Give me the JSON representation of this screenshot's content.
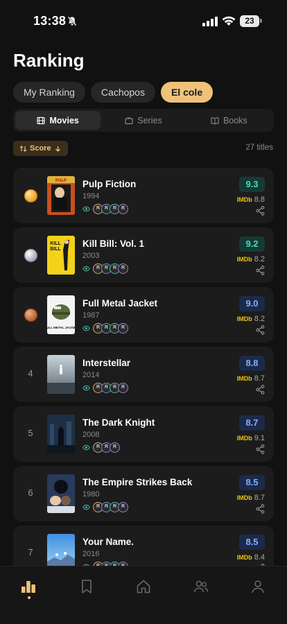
{
  "status": {
    "time": "13:38",
    "battery": "23"
  },
  "page": {
    "title": "Ranking"
  },
  "chips": [
    {
      "label": "My Ranking",
      "active": false
    },
    {
      "label": "Cachopos",
      "active": false
    },
    {
      "label": "El cole",
      "active": true
    }
  ],
  "segments": [
    {
      "label": "Movies",
      "icon": "film-icon",
      "active": true
    },
    {
      "label": "Series",
      "icon": "tv-icon",
      "active": false
    },
    {
      "label": "Books",
      "icon": "book-icon",
      "active": false
    }
  ],
  "sort": {
    "label": "Score"
  },
  "count": "27 titles",
  "imdb_label": "IMDb",
  "avatar_letter": "R",
  "items": [
    {
      "rank": "1",
      "medal": "gold",
      "title": "Pulp Fiction",
      "year": "1994",
      "score": "9.3",
      "score_style": "teal",
      "imdb": "8.8",
      "watchers": 4
    },
    {
      "rank": "2",
      "medal": "silver",
      "title": "Kill Bill: Vol. 1",
      "year": "2003",
      "score": "9.2",
      "score_style": "teal",
      "imdb": "8.2",
      "watchers": 4
    },
    {
      "rank": "3",
      "medal": "bronze",
      "title": "Full Metal Jacket",
      "year": "1987",
      "score": "9.0",
      "score_style": "blue",
      "imdb": "8.2",
      "watchers": 4
    },
    {
      "rank": "4",
      "medal": "",
      "title": "Interstellar",
      "year": "2014",
      "score": "8.8",
      "score_style": "blue",
      "imdb": "8.7",
      "watchers": 4
    },
    {
      "rank": "5",
      "medal": "",
      "title": "The Dark Knight",
      "year": "2008",
      "score": "8.7",
      "score_style": "blue",
      "imdb": "9.1",
      "watchers": 3
    },
    {
      "rank": "6",
      "medal": "",
      "title": "The Empire Strikes Back",
      "year": "1980",
      "score": "8.5",
      "score_style": "blue",
      "imdb": "8.7",
      "watchers": 4
    },
    {
      "rank": "7",
      "medal": "",
      "title": "Your Name.",
      "year": "2016",
      "score": "8.5",
      "score_style": "blue",
      "imdb": "8.4",
      "watchers": 4
    }
  ],
  "colors": {
    "accent": "#efc27a",
    "teal": "#3fe0bf",
    "blue": "#7fb1ff",
    "imdb": "#f2c311",
    "avatar_rings": [
      "#d9a55a",
      "#6b8cd6",
      "#3fbf9f",
      "#a07ad6"
    ]
  },
  "tabs": [
    {
      "name": "tab-ranking",
      "icon": "bar-chart-icon",
      "active": true
    },
    {
      "name": "tab-saved",
      "icon": "bookmark-icon",
      "active": false
    },
    {
      "name": "tab-home",
      "icon": "home-icon",
      "active": false
    },
    {
      "name": "tab-friends",
      "icon": "people-icon",
      "active": false
    },
    {
      "name": "tab-profile",
      "icon": "user-icon",
      "active": false
    }
  ]
}
